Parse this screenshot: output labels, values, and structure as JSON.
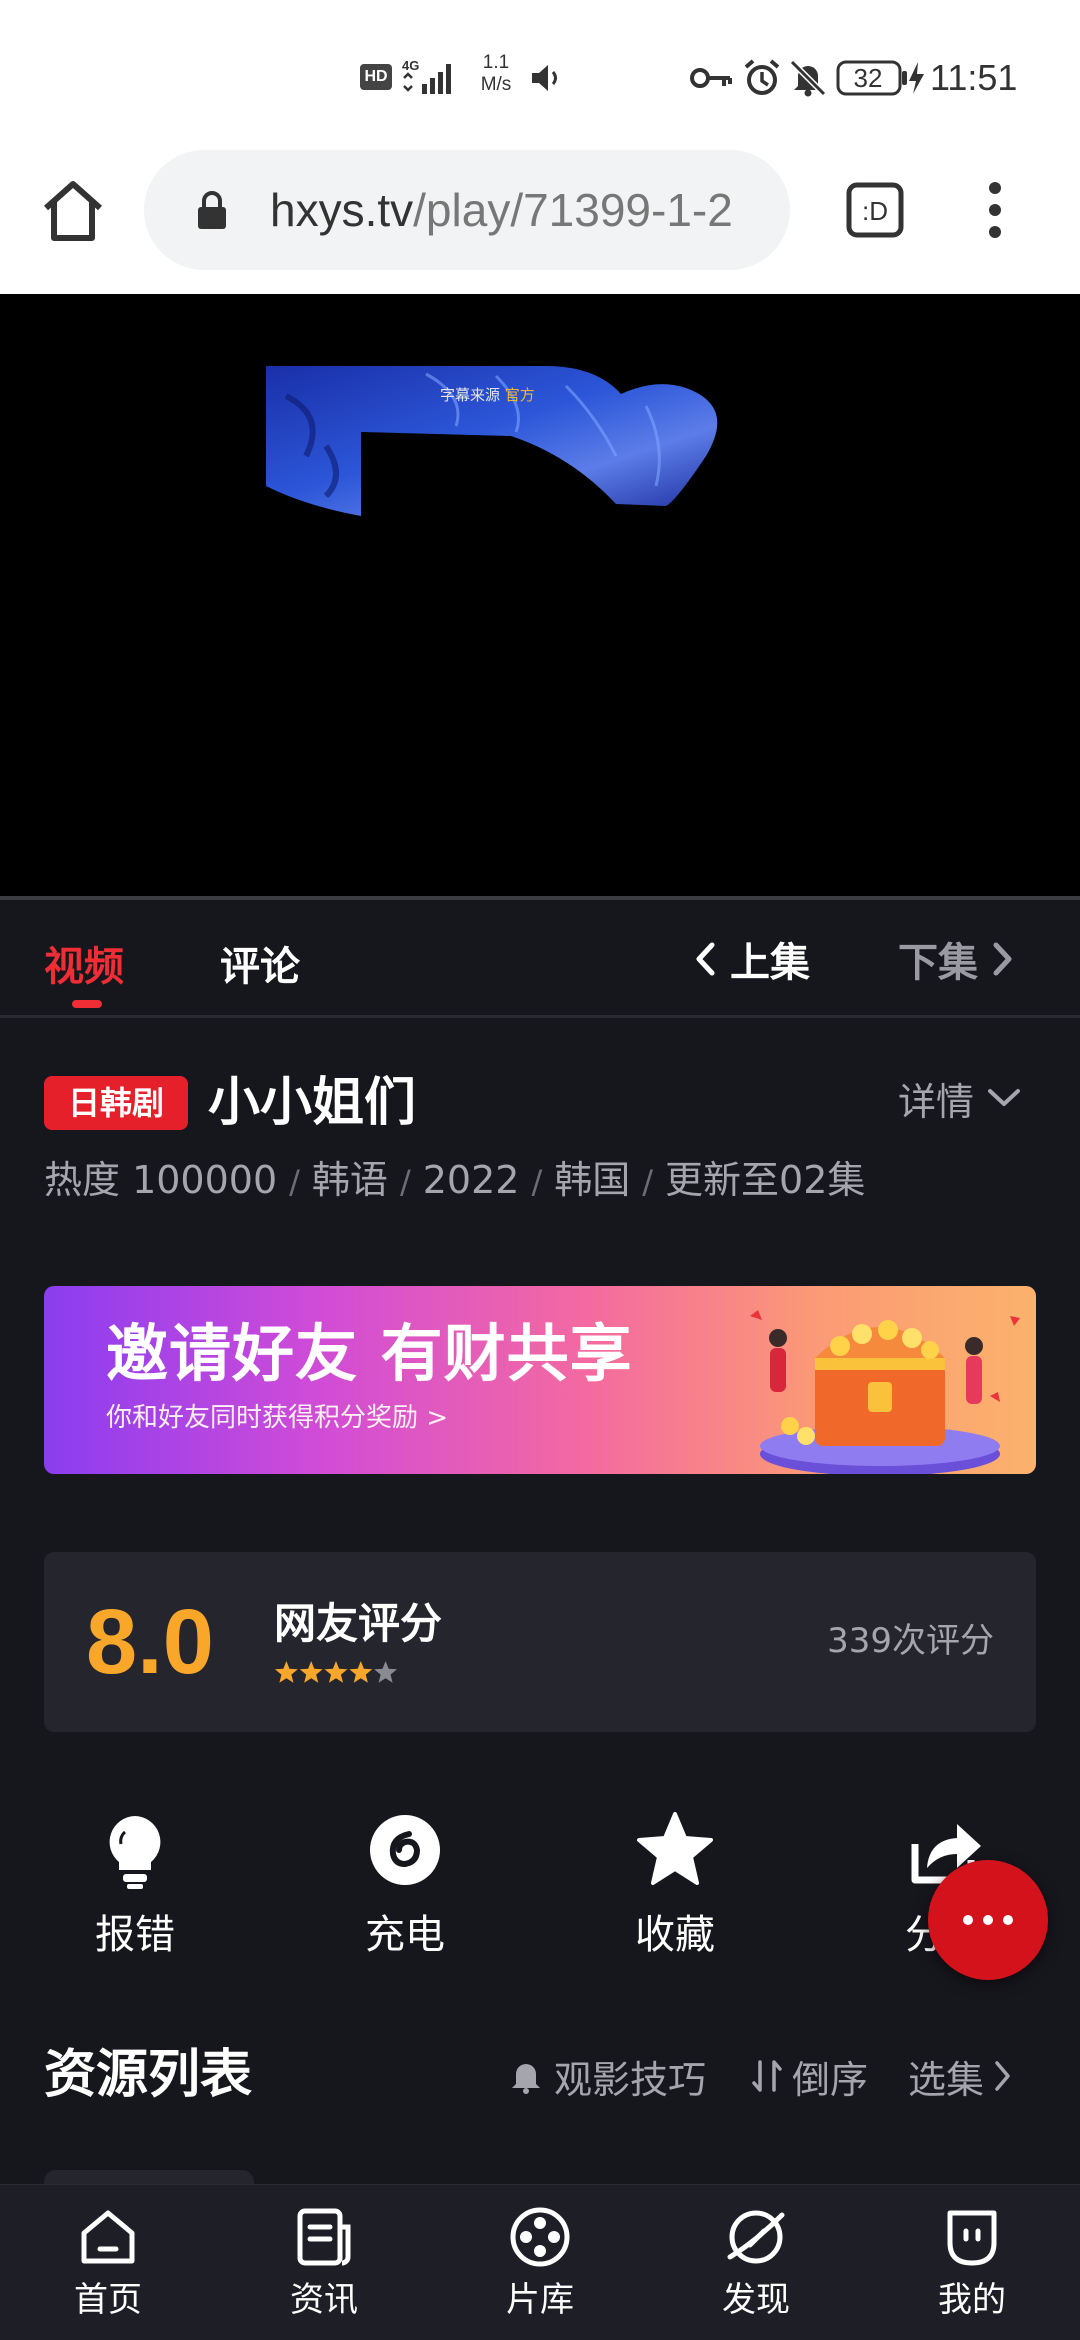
{
  "status_bar": {
    "hd_badge": "HD",
    "network": "4G",
    "speed_value": "1.1",
    "speed_unit": "M/s",
    "battery": "32",
    "time": "11:51"
  },
  "browser": {
    "url_host": "hxys.tv",
    "url_path": "/play/71399-1-2",
    "tabs_label": ":D"
  },
  "video": {
    "subtitle_source_prefix": "字幕来源",
    "subtitle_source_highlight": "官方"
  },
  "tabs": {
    "video": "视频",
    "comment": "评论",
    "prev_episode": "上集",
    "next_episode": "下集"
  },
  "show": {
    "genre": "日韩剧",
    "title": "小小姐们",
    "details_label": "详情",
    "meta": {
      "heat": "热度 100000",
      "language": "韩语",
      "year": "2022",
      "region": "韩国",
      "update": "更新至02集"
    },
    "meta_separator": "/"
  },
  "banner": {
    "title": "邀请好友 有财共享",
    "subtitle": "你和好友同时获得积分奖励 >"
  },
  "rating": {
    "score": "8.0",
    "label": "网友评分",
    "stars_filled": 4,
    "stars_total": 5,
    "count": "339次评分",
    "accent_color": "#f9a72b"
  },
  "actions": {
    "report": "报错",
    "charge": "充电",
    "favorite": "收藏",
    "share": "分享"
  },
  "resources": {
    "title": "资源列表",
    "tips": "观影技巧",
    "sort": "倒序",
    "episodes": "选集"
  },
  "bottom_nav": {
    "home": "首页",
    "news": "资讯",
    "library": "片库",
    "discover": "发现",
    "mine": "我的"
  },
  "colors": {
    "accent_red": "#f02d35",
    "background": "#16161d",
    "card": "#25252d"
  }
}
